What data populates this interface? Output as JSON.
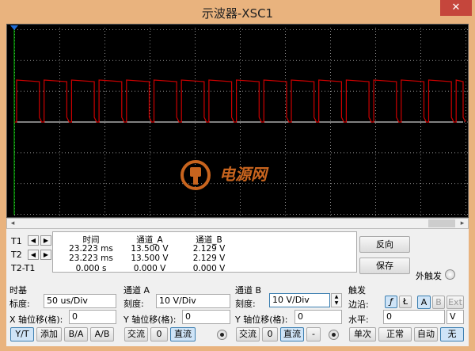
{
  "window": {
    "title": "示波器-XSC1",
    "close_label": "✕"
  },
  "scope": {
    "background_color": "#000000",
    "trace_a_color": "#cc0000",
    "trace_b_color": "#ffffff",
    "cursor_color": "#00cc00",
    "grid_color": "#888888",
    "watermark_text": "电源网"
  },
  "readout": {
    "headers": [
      "时间",
      "通道_A",
      "通道_B"
    ],
    "rows": [
      {
        "label": "T1",
        "values": [
          "23.223 ms",
          "13.500 V",
          "2.129 V"
        ]
      },
      {
        "label": "T2",
        "values": [
          "23.223 ms",
          "13.500 V",
          "2.129 V"
        ]
      },
      {
        "label": "T2-T1",
        "values": [
          "0.000 s",
          "0.000 V",
          "0.000 V"
        ]
      }
    ]
  },
  "side_buttons": {
    "reverse": "反向",
    "save": "保存",
    "ext_trigger": "外触发"
  },
  "timebase": {
    "section": "时基",
    "scale_label": "标度:",
    "scale_value": "50 us/Div",
    "xpos_label": "X 轴位移(格):",
    "xpos_value": "0",
    "mode_buttons": [
      "Y/T",
      "添加",
      "B/A",
      "A/B"
    ]
  },
  "channel_a": {
    "section": "通道 A",
    "scale_label": "刻度:",
    "scale_value": "10  V/Div",
    "ypos_label": "Y 轴位移(格):",
    "ypos_value": "0",
    "coupling": [
      "交流",
      "0",
      "直流"
    ]
  },
  "channel_b": {
    "section": "通道 B",
    "scale_label": "刻度:",
    "scale_value": "10  V/Div",
    "ypos_label": "Y 轴位移(格):",
    "ypos_value": "0",
    "coupling": [
      "交流",
      "0",
      "直流",
      "-"
    ]
  },
  "trigger": {
    "section": "触发",
    "edge_label": "边沿:",
    "edge_rise": "ƒ",
    "edge_fall": "Ł",
    "sources": [
      "A",
      "B",
      "Ext"
    ],
    "level_label": "水平:",
    "level_value": "0",
    "level_unit": "V",
    "modes": [
      "单次",
      "正常",
      "自动",
      "无"
    ]
  }
}
